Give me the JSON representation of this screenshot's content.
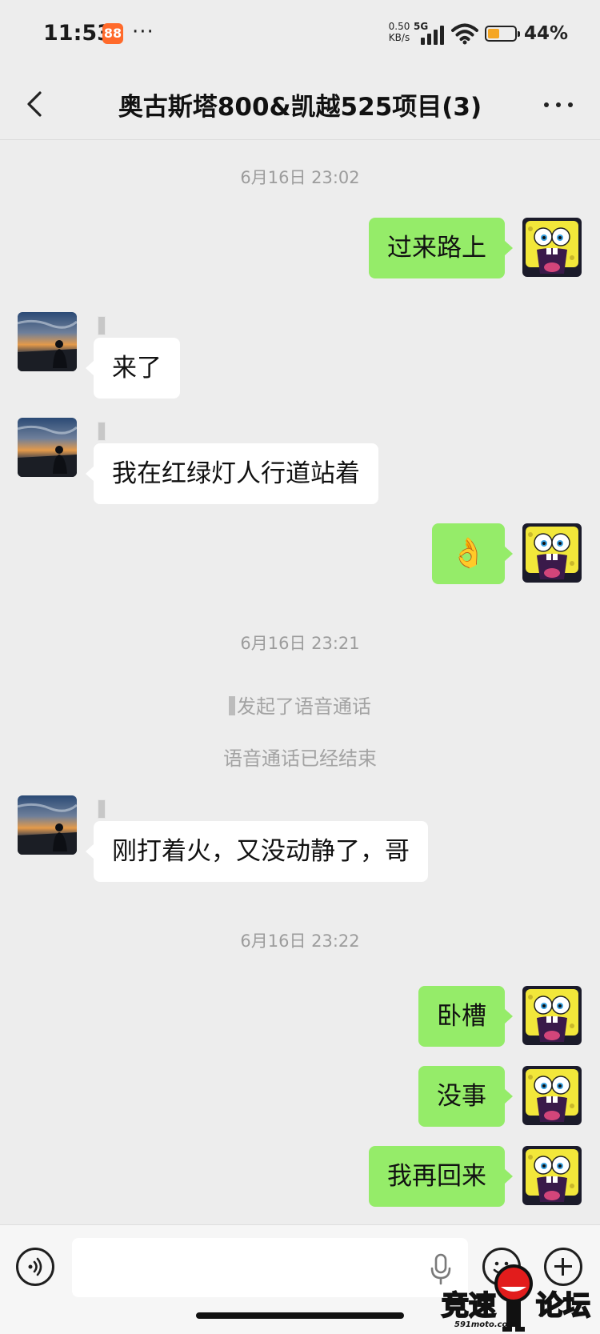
{
  "status_bar": {
    "time": "11:53",
    "app_icon_glyph": "88",
    "more_dots": "···",
    "net_speed_value": "0.50",
    "net_speed_unit": "KB/s",
    "network_type": "5G",
    "battery_percent": "44%",
    "battery_level": 0.44,
    "battery_color": "#f5a623"
  },
  "nav": {
    "title": "奥古斯塔800&凯越525项目(3)",
    "back_icon": "chevron-left-icon",
    "more_icon": "more-dots-icon"
  },
  "chat": {
    "timestamps": [
      "6月16日 23:02",
      "6月16日 23:21",
      "6月16日 23:22"
    ],
    "messages": {
      "m1": "过来路上",
      "m2": "来了",
      "m3": "我在红绿灯人行道站着",
      "m4": "👌",
      "m6": "刚打着火，又没动静了，哥",
      "m7": "卧槽",
      "m8": "没事",
      "m9": "我再回来"
    },
    "system": {
      "call_started": "发起了语音通话",
      "call_ended": "语音通话已经结束"
    }
  },
  "input_bar": {
    "text_value": "",
    "voice_icon": "voice-icon",
    "mic_icon": "mic-icon",
    "emoji_icon": "emoji-icon",
    "plus_icon": "plus-icon"
  },
  "watermark": {
    "left": "竞速",
    "right": "论坛",
    "url": "591moto.com"
  },
  "colors": {
    "background": "#ededed",
    "outgoing_bubble": "#95ec69",
    "incoming_bubble": "#ffffff"
  }
}
